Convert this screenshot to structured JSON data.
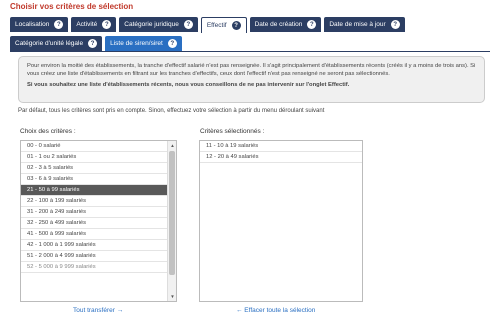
{
  "page": {
    "title": "Choisir vos critères de sélection"
  },
  "tabs_row1": [
    {
      "label": "Localisation",
      "help": "?"
    },
    {
      "label": "Activité",
      "help": "?"
    },
    {
      "label": "Catégorie juridique",
      "help": "?"
    },
    {
      "label": "Effectif",
      "help": "?"
    },
    {
      "label": "Date de création",
      "help": "?"
    },
    {
      "label": "Date de mise à jour",
      "help": "?"
    }
  ],
  "tabs_row2": [
    {
      "label": "Catégorie d'unité légale",
      "help": "?"
    },
    {
      "label": "Liste de siren/siret",
      "help": "?"
    }
  ],
  "info": {
    "line1": "Pour environ la moitié des établissements, la tranche d'effectif salarié n'est pas renseignée. Il s'agit principalement d'établissements récents (créés il y a moins de trois ans). Si vous créez une liste d'établissements en filtrant sur les tranches d'effectifs, ceux dont l'effectif n'est pas renseigné ne seront pas sélectionnés.",
    "line2": "Si vous souhaitez une liste d'établissements récents, nous vous conseillons de ne pas intervenir sur l'onglet Effectif."
  },
  "default_text": "Par défaut, tous les critères sont pris en compte. Sinon, effectuez votre sélection à partir du menu déroulant suivant",
  "choices": {
    "label": "Choix des critères :",
    "options": [
      "00 - 0 salarié",
      "01 - 1 ou 2 salariés",
      "02 - 3 à 5 salariés",
      "03 - 6 à 9 salariés",
      "21 - 50 à 99 salariés",
      "22 - 100 à 199 salariés",
      "31 - 200 à 249 salariés",
      "32 - 250 à 499 salariés",
      "41 - 500 à 999 salariés",
      "42 - 1 000 à 1 999 salariés",
      "51 - 2 000 à 4 999 salariés",
      "52 - 5 000 à 9 999 salariés"
    ],
    "selected": "21 - 50 à 99 salariés"
  },
  "selected_criteria": {
    "label": "Critères sélectionnés :",
    "options": [
      "11 - 10 à 19 salariés",
      "12 - 20 à 49 salariés"
    ]
  },
  "links": {
    "transfer_all": "Tout transférer →",
    "clear_all": "← Effacer toute la sélection"
  },
  "icons": {
    "help": "question-circle-icon",
    "scroll_up": "triangle-up-icon",
    "scroll_down": "triangle-down-icon"
  },
  "colors": {
    "title": "#c0392b",
    "tab_bg": "#2c3e63",
    "tab_selected": "#2a6fc2",
    "link": "#2a6fc2",
    "selected_option": "#595959"
  }
}
